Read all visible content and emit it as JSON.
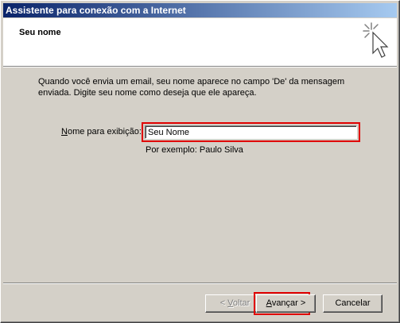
{
  "window": {
    "title": "Assistente para conexão com a Internet"
  },
  "header": {
    "title": "Seu nome",
    "icon": "sparkle-cursor-icon"
  },
  "main": {
    "description": "Quando você envia um email, seu nome aparece no campo 'De' da mensagem enviada. Digite seu nome como deseja que ele apareça.",
    "display_name_label_first": "N",
    "display_name_label_rest": "ome para exibição:",
    "display_name_value": "Seu Nome",
    "example_text": "Por exemplo: Paulo Silva"
  },
  "footer": {
    "back_prefix": "< ",
    "back_underlined": "V",
    "back_rest": "oltar",
    "next_underlined": "A",
    "next_rest": "vançar >",
    "cancel_label": "Cancelar"
  },
  "colors": {
    "highlight": "#e00000",
    "titlebar_start": "#0a246a",
    "titlebar_end": "#a6caf0",
    "dialog_bg": "#d4d0c8"
  }
}
